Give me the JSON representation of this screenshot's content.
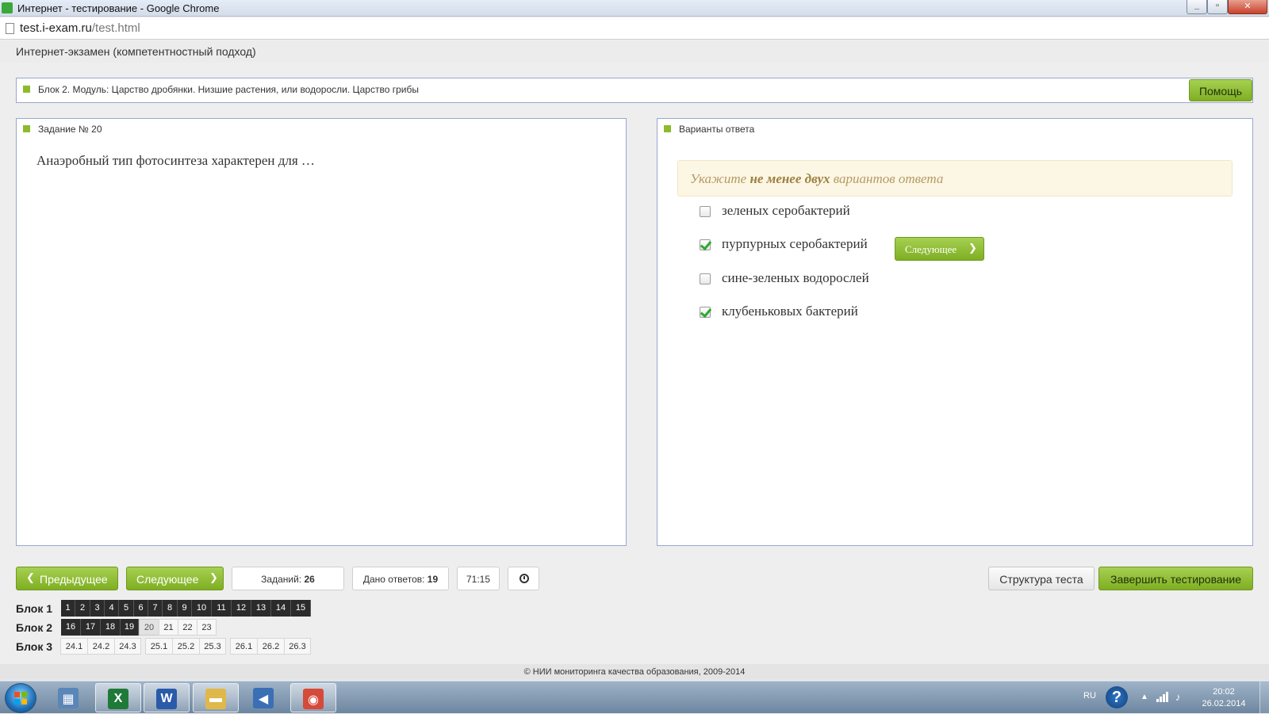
{
  "window": {
    "title": "Интернет - тестирование - Google Chrome",
    "controls": {
      "minimize": "_",
      "maximize": "▫",
      "close": "✕"
    }
  },
  "browser": {
    "url_host": "test.i-exam.ru",
    "url_path": "/test.html"
  },
  "app": {
    "header_title": "Интернет-экзамен (компетентностный подход)",
    "block_title": "Блок 2. Модуль: Царство дробянки. Низшие растения, или водоросли. Царство грибы",
    "help_label": "Помощь"
  },
  "task": {
    "label": "Задание № 20",
    "question": "Анаэробный тип фотосинтеза характерен для …"
  },
  "answers": {
    "label": "Варианты ответа",
    "hint_prefix": "Укажите ",
    "hint_bold": "не менее двух",
    "hint_suffix": " вариантов ответа",
    "options": [
      {
        "text": "зеленых серобактерий",
        "checked": false
      },
      {
        "text": "пурпурных серобактерий",
        "checked": true
      },
      {
        "text": "сине-зеленых водорослей",
        "checked": false
      },
      {
        "text": "клубеньковых бактерий",
        "checked": true
      }
    ],
    "inline_next_label": "Следующее",
    "inline_next_arrow": "❯"
  },
  "nav": {
    "prev_label": "Предыдущее",
    "prev_arrow": "❮",
    "next_label": "Следующее",
    "next_arrow": "❯",
    "tasks_label": "Заданий:",
    "tasks_count": "26",
    "answered_label": "Дано ответов:",
    "answered_count": "19",
    "timer": "71:15",
    "structure_label": "Структура теста",
    "finish_label": "Завершить тестирование"
  },
  "blocks": [
    {
      "label": "Блок 1",
      "cells": [
        {
          "n": "1",
          "s": "done",
          "w": 18
        },
        {
          "n": "2",
          "s": "done",
          "w": 19
        },
        {
          "n": "3",
          "s": "done",
          "w": 18
        },
        {
          "n": "4",
          "s": "done",
          "w": 18
        },
        {
          "n": "5",
          "s": "done",
          "w": 19
        },
        {
          "n": "6",
          "s": "done",
          "w": 18
        },
        {
          "n": "7",
          "s": "done",
          "w": 18
        },
        {
          "n": "8",
          "s": "done",
          "w": 19
        },
        {
          "n": "9",
          "s": "done",
          "w": 18
        },
        {
          "n": "10",
          "s": "done",
          "w": 25
        },
        {
          "n": "11",
          "s": "done",
          "w": 25
        },
        {
          "n": "12",
          "s": "done",
          "w": 25
        },
        {
          "n": "13",
          "s": "done",
          "w": 25
        },
        {
          "n": "14",
          "s": "done",
          "w": 25
        },
        {
          "n": "15",
          "s": "done",
          "w": 25
        }
      ]
    },
    {
      "label": "Блок 2",
      "cells": [
        {
          "n": "16",
          "s": "done",
          "w": 25
        },
        {
          "n": "17",
          "s": "done",
          "w": 25
        },
        {
          "n": "18",
          "s": "done",
          "w": 25
        },
        {
          "n": "19",
          "s": "done",
          "w": 23
        },
        {
          "n": "20",
          "s": "cur",
          "w": 26
        },
        {
          "n": "21",
          "s": "todo",
          "w": 25
        },
        {
          "n": "22",
          "s": "todo",
          "w": 25
        },
        {
          "n": "23",
          "s": "todo",
          "w": 25
        }
      ]
    },
    {
      "label": "Блок 3",
      "cells": [
        {
          "n": "24.1",
          "s": "todo",
          "w": 35
        },
        {
          "n": "24.2",
          "s": "todo",
          "w": 35
        },
        {
          "n": "24.3",
          "s": "todo",
          "w": 34
        },
        {
          "n": "25.1",
          "s": "todo",
          "w": 35,
          "gap": true
        },
        {
          "n": "25.2",
          "s": "todo",
          "w": 35
        },
        {
          "n": "25.3",
          "s": "todo",
          "w": 34
        },
        {
          "n": "26.1",
          "s": "todo",
          "w": 35,
          "gap": true
        },
        {
          "n": "26.2",
          "s": "todo",
          "w": 35
        },
        {
          "n": "26.3",
          "s": "todo",
          "w": 34
        }
      ]
    }
  ],
  "footer": "© НИИ мониторинга качества образования, 2009-2014",
  "taskbar": {
    "items": [
      {
        "name": "calculator-icon",
        "color": "#5a86b8",
        "glyph": "▦",
        "open": false
      },
      {
        "name": "excel-icon",
        "color": "#1f7a3a",
        "glyph": "X",
        "open": true
      },
      {
        "name": "word-icon",
        "color": "#2a5aa8",
        "glyph": "W",
        "open": true
      },
      {
        "name": "explorer-folder-icon",
        "color": "#e0b84a",
        "glyph": "▬",
        "open": true
      },
      {
        "name": "media-player-icon",
        "color": "#3a6fb5",
        "glyph": "◀",
        "open": false
      },
      {
        "name": "chrome-icon",
        "color": "#d64a3a",
        "glyph": "◉",
        "open": true
      }
    ],
    "lang": "RU",
    "help_glyph": "?",
    "tray_arrow": "▲",
    "volume_glyph": "♪",
    "time": "20:02",
    "date": "26.02.2014"
  },
  "colors": {
    "accent_green": "#8dbb2d",
    "done_cell": "#2b2b2b",
    "panel_border": "#9aa6d0",
    "hint_bg": "#fcf6e4"
  }
}
